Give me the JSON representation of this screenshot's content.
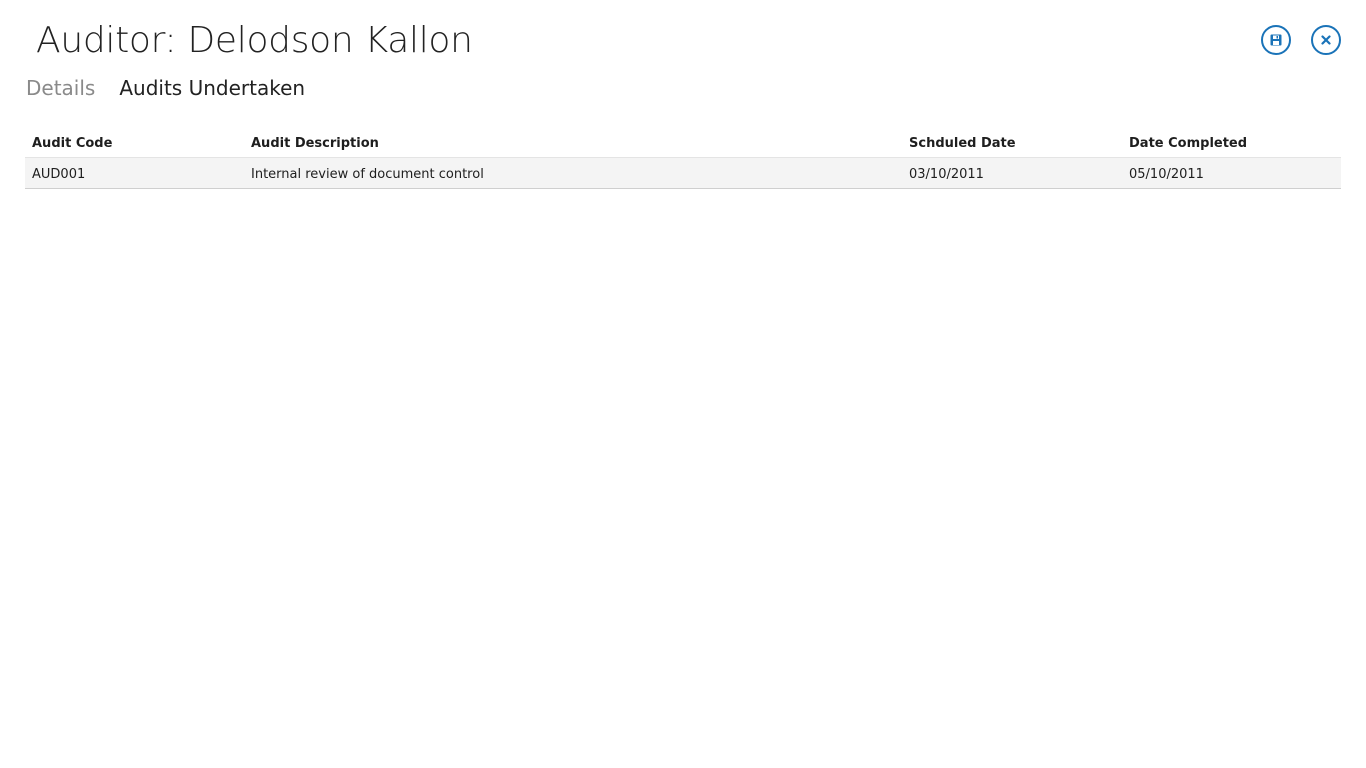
{
  "header": {
    "title": "Auditor: Delodson Kallon",
    "save_icon": "save-icon",
    "close_icon": "close-icon",
    "accent_color": "#1a73b8"
  },
  "tabs": [
    {
      "label": "Details",
      "active": false
    },
    {
      "label": "Audits Undertaken",
      "active": true
    }
  ],
  "table": {
    "columns": [
      "Audit Code",
      "Audit Description",
      "Schduled Date",
      "Date Completed"
    ],
    "rows": [
      [
        "AUD001",
        "Internal review of document control",
        "03/10/2011",
        "05/10/2011"
      ]
    ]
  }
}
